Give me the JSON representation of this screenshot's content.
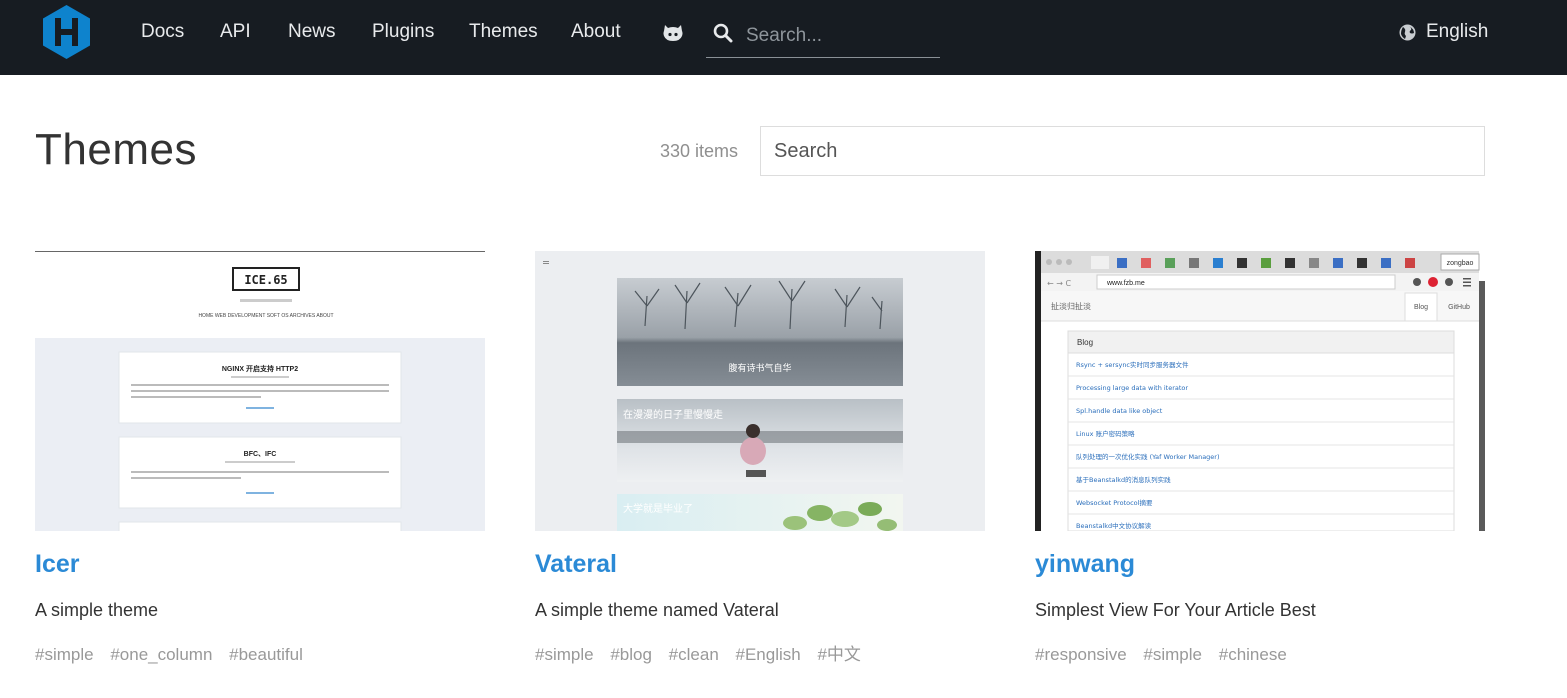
{
  "nav": {
    "links": [
      "Docs",
      "API",
      "News",
      "Plugins",
      "Themes",
      "About"
    ],
    "search_placeholder": "Search...",
    "language": "English"
  },
  "page": {
    "title": "Themes",
    "count": "330 items",
    "search_placeholder": "Search"
  },
  "themes": [
    {
      "name": "Icer",
      "description": "A simple theme",
      "tags": [
        "#simple",
        "#one_column",
        "#beautiful"
      ],
      "preview": {
        "logo": "ICE.65",
        "posts": [
          "NGINX 开启支持 HTTP2",
          "BFC、IFC"
        ],
        "menu": "HOME  WEB DEVELOPMENT  SOFT  OS  ARCHIVES  ABOUT"
      }
    },
    {
      "name": "Vateral",
      "description": "A simple theme named Vateral",
      "tags": [
        "#simple",
        "#blog",
        "#clean",
        "#English",
        "#中文"
      ],
      "preview": {
        "banners": [
          "腹有诗书气自华",
          "在漫漫的日子里慢慢走",
          "大学就是毕业了"
        ]
      }
    },
    {
      "name": "yinwang",
      "description": "Simplest View For Your Article Best",
      "tags": [
        "#responsive",
        "#simple",
        "#chinese"
      ],
      "preview": {
        "url": "www.fzb.me",
        "site": "扯淡归扯淡",
        "nav": [
          "Blog",
          "GitHub"
        ],
        "user": "zongbao",
        "list_header": "Blog",
        "list": [
          "Rsync + sersync实时同步服务器文件",
          "Processing large data with iterator",
          "Spl.handle data like object",
          "Linux 账户密码策略",
          "队列处理的一次优化实践 (Yaf Worker Manager)",
          "基于Beanstalkd的消息队列实践",
          "Websocket Protocol摘要",
          "Beanstalkd中文协议解读"
        ]
      }
    }
  ]
}
